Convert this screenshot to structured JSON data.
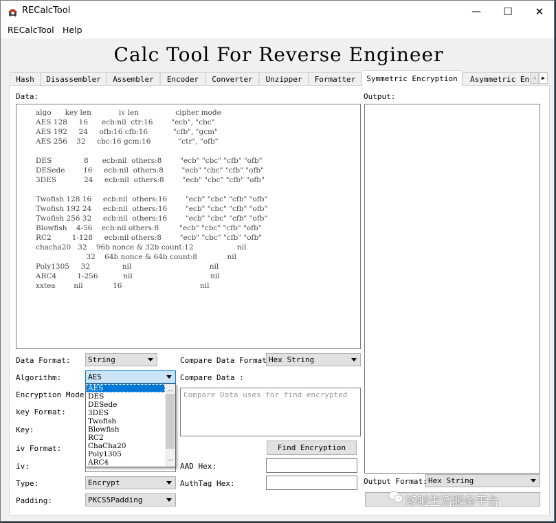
{
  "window": {
    "title": "RECalcTool",
    "controls": {
      "minimize": "—",
      "maximize": "☐",
      "close": "✕"
    }
  },
  "menu": [
    "RECalcTool",
    "Help"
  ],
  "heading": "Calc Tool For Reverse Engineer",
  "tabs": [
    {
      "label": "Hash",
      "active": false
    },
    {
      "label": "Disassembler",
      "active": false
    },
    {
      "label": "Assembler",
      "active": false
    },
    {
      "label": "Encoder",
      "active": false
    },
    {
      "label": "Converter",
      "active": false
    },
    {
      "label": "Unzipper",
      "active": false
    },
    {
      "label": "Formatter",
      "active": false
    },
    {
      "label": "Symmetric Encryption",
      "active": true
    },
    {
      "label": "Asymmetric Enc",
      "active": false
    }
  ],
  "tab_scroll": {
    "left": "◀",
    "right": "▶"
  },
  "data": {
    "label": "Data:",
    "lines": [
      "algo      key len            iv len                cipher mode",
      "AES 128     16      ecb:nil  ctr:16        \"ecb\", \"cbc\"",
      "AES 192     24     ofb:16 cfb:16           \"cfb\", \"gcm\"",
      "AES 256    32     cbc:16 gcm:16            \"ctr\", \"ofb\"",
      "",
      "DES              8      ecb:nil  others:8        \"ecb\" \"cbc\" \"cfb\" \"ofb\"",
      "DESede        16     ecb:nil  others:8        \"ecb\" \"cbc\" \"cfb\" \"ofb\"",
      "3DES            24     ecb:nil  others:8        \"ecb\" \"cbc\" \"cfb\" \"ofb\"",
      "",
      "Twofish 128 16     ecb:nil  others:16        \"ecb\" \"cbc\" \"cfb\" \"ofb\"",
      "Twofish 192 24     ecb:nil  others:16        \"ecb\" \"cbc\" \"cfb\" \"ofb\"",
      "Twofish 256 32     ecb:nil  others:16        \"ecb\" \"cbc\" \"cfb\" \"ofb\"",
      "Blowfish    4-56    ecb:nil others:8         \"ecb\" \"cbc\" \"cfb\" \"ofb\"",
      "RC2         1-128     ecb:nil others:8        \"ecb\" \"cbc\" \"cfb\" \"ofb\"",
      "chacha20   32    96b nonce & 32b count:12                   nil",
      "                      32    64b nonce & 64b count:8             nil",
      "Poly1305     32              nil                                  nil",
      "ARC4         1-256           nil                                  nil",
      "xxtea        nil             16                                  nil"
    ]
  },
  "output": {
    "label": "Output:"
  },
  "form": {
    "data_format": {
      "label": "Data Format:",
      "value": "String"
    },
    "algorithm": {
      "label": "Algorithm:",
      "value": "AES",
      "options": [
        "AES",
        "DES",
        "DESede",
        "3DES",
        "Twofish",
        "Blowfish",
        "RC2",
        "ChaCha20",
        "Poly1305",
        "ARC4"
      ]
    },
    "encryption_mode": {
      "label": "Encryption Mode:"
    },
    "key_format": {
      "label": "key Format:"
    },
    "key": {
      "label": "Key:"
    },
    "iv_format": {
      "label": "iv Format:"
    },
    "iv": {
      "label": "iv:"
    },
    "type": {
      "label": "Type:",
      "value": "Encrypt"
    },
    "padding": {
      "label": "Padding:",
      "value": "PKCS5Padding"
    }
  },
  "compare": {
    "format_label": "Compare Data Format:",
    "format_value": "Hex String",
    "data_label": "Compare Data :",
    "placeholder": "Compare Data uses for find encrypted",
    "find_button": "Find Encryption",
    "aad_label": "AAD Hex:",
    "authtag_label": "AuthTag Hex:"
  },
  "output_format": {
    "label": "Output Format:",
    "value": "Hex String"
  },
  "watermark": "哆啦生活服务平台"
}
